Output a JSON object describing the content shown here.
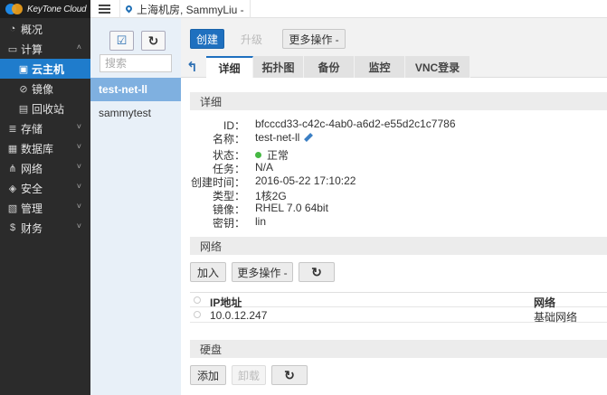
{
  "brand": {
    "name": "KeyTone Cloud"
  },
  "sidebar": {
    "items": [
      {
        "label": "概况",
        "icon": "dashboard-icon"
      },
      {
        "label": "计算",
        "icon": "monitor-icon",
        "chevron": "˄"
      },
      {
        "label": "云主机",
        "icon": "vm-icon",
        "active": true
      },
      {
        "label": "镜像",
        "icon": "image-icon"
      },
      {
        "label": "回收站",
        "icon": "trash-icon"
      },
      {
        "label": "存储",
        "icon": "storage-icon",
        "chevron": "˅"
      },
      {
        "label": "数据库",
        "icon": "database-icon",
        "chevron": "˅"
      },
      {
        "label": "网络",
        "icon": "network-icon",
        "chevron": "˅"
      },
      {
        "label": "安全",
        "icon": "shield-icon",
        "chevron": "˅"
      },
      {
        "label": "管理",
        "icon": "manage-icon",
        "chevron": "˅"
      },
      {
        "label": "财务",
        "icon": "dollar-icon",
        "chevron": "˅"
      }
    ]
  },
  "topbar": {
    "region": "上海机房, SammyLiu -"
  },
  "list": {
    "search_placeholder": "搜索",
    "items": [
      "test-net-ll",
      "sammytest"
    ]
  },
  "toolbar": {
    "create": "创建",
    "upgrade": "升级",
    "more": "更多操作 -"
  },
  "tabs": [
    "详细",
    "拓扑图",
    "备份",
    "监控",
    "VNC登录"
  ],
  "details": {
    "header": "详细",
    "rows": [
      {
        "k": "ID：",
        "v": "bfcccd33-c42c-4ab0-a6d2-e55d2c1c7786"
      },
      {
        "k": "名称：",
        "v": "test-net-ll"
      },
      {
        "k": "状态：",
        "v": "正常"
      },
      {
        "k": "任务：",
        "v": "N/A"
      },
      {
        "k": "创建时间：",
        "v": "2016-05-22 17:10:22"
      },
      {
        "k": "类型：",
        "v": "1核2G"
      },
      {
        "k": "镜像：",
        "v": "RHEL 7.0 64bit"
      },
      {
        "k": "密钥：",
        "v": "lin"
      }
    ]
  },
  "network": {
    "header": "网络",
    "add": "加入",
    "more": "更多操作 -",
    "columns": [
      "IP地址",
      "网络"
    ],
    "rows": [
      {
        "ip": "10.0.12.247",
        "net": "基础网络"
      }
    ]
  },
  "disk": {
    "header": "硬盘",
    "add": "添加",
    "unmount": "卸载"
  },
  "icons": {
    "refresh": "↻",
    "back": "↰",
    "checkbox": "☑"
  },
  "colors": {
    "accent": "#1f70bf",
    "sidebar": "#2b2b2b",
    "active": "#1f7ccc",
    "status_ok": "#46b843"
  }
}
